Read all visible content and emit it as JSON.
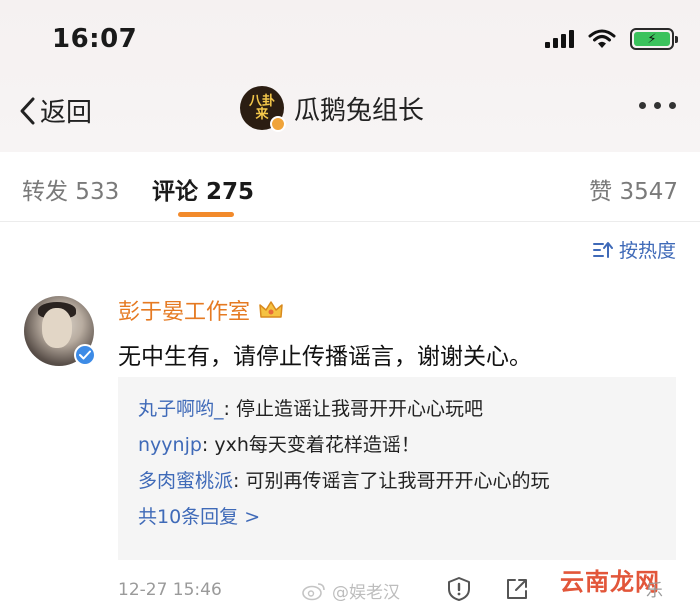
{
  "status_bar": {
    "time": "16:07"
  },
  "nav": {
    "back_label": "返回",
    "avatar_text": "八卦来",
    "title": "瓜鹅兔组长"
  },
  "tabs": {
    "forward": "转发 533",
    "comment": "评论 275",
    "like": "赞 3547"
  },
  "sort_label": "按热度",
  "comment": {
    "author": "彭于晏工作室",
    "text": "无中生有，请停止传播谣言，谢谢关心。",
    "replies": [
      {
        "user": "丸子啊哟_",
        "text": ": 停止造谣让我哥开开心心玩吧"
      },
      {
        "user": "nyynjp",
        "text": ": yxh每天变着花样造谣！"
      },
      {
        "user": "多肉蜜桃派",
        "text": ": 可别再传谣言了让我哥开开心心的玩"
      }
    ],
    "more_replies": "共10条回复 >",
    "time": "12-27 15:46"
  },
  "watermarks": {
    "weibo": "@娱老汉",
    "site": "云南龙网",
    "site_tail": "乐"
  },
  "colors": {
    "accent": "#f28a2b",
    "link": "#3f6ab8",
    "author": "#e57a22",
    "verified": "#3d8be6"
  }
}
